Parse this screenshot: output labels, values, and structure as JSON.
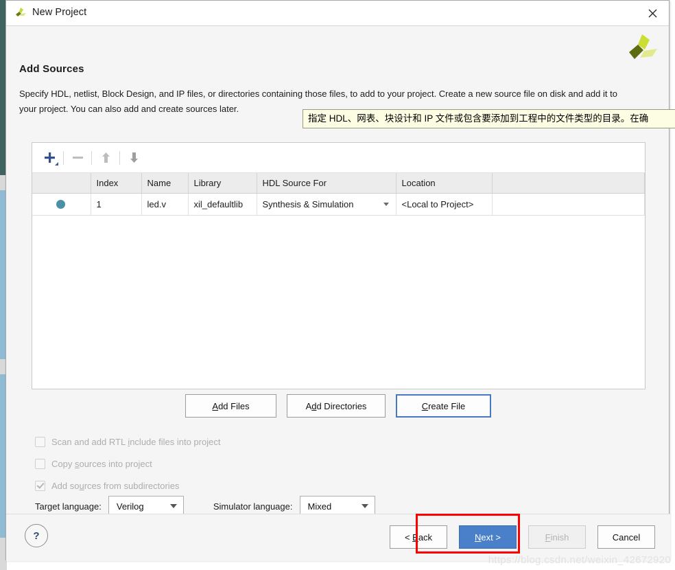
{
  "window": {
    "title": "New Project",
    "logo_icon": "vivado-logo-icon",
    "close_icon": "close-icon"
  },
  "header": {
    "title": "Add Sources",
    "description": "Specify HDL, netlist, Block Design, and IP files, or directories containing those files, to add to your project. Create a new source file on disk and add it to your project. You can also add and create sources later.",
    "logo_icon": "xilinx-pinwheel-logo-icon"
  },
  "tooltip": {
    "text": "指定 HDL、网表、块设计和 IP 文件或包含要添加到工程中的文件类型的目录。在确"
  },
  "table_toolbar": {
    "add_icon": "plus-icon",
    "remove_icon": "minus-icon",
    "move_up_icon": "arrow-up-icon",
    "move_down_icon": "arrow-down-icon"
  },
  "sources_table": {
    "columns": [
      "",
      "Index",
      "Name",
      "Library",
      "HDL Source For",
      "Location",
      ""
    ],
    "rows": [
      {
        "selected_marker": "selected-dot",
        "index": "1",
        "name": "led.v",
        "library": "xil_defaultlib",
        "hdl_source_for": "Synthesis & Simulation",
        "location": "<Local to Project>"
      }
    ]
  },
  "action_buttons": {
    "add_files": "Add Files",
    "add_files_mnemonic": "A",
    "add_files_rest": "dd Files",
    "add_directories_pre": "A",
    "add_directories_mnemonic": "d",
    "add_directories_rest": "d Directories",
    "create_file_mnemonic": "C",
    "create_file_rest": "reate File"
  },
  "options": [
    {
      "label_pre": "Scan and add RTL ",
      "label_mnemonic": "i",
      "label_rest": "nclude files into project",
      "checked": false,
      "enabled": false
    },
    {
      "label_pre": "Copy ",
      "label_mnemonic": "s",
      "label_rest": "ources into project",
      "checked": false,
      "enabled": false
    },
    {
      "label_pre": "Add so",
      "label_mnemonic": "u",
      "label_rest": "rces from subdirectories",
      "checked": true,
      "enabled": false
    }
  ],
  "languages": {
    "target_label": "Target language:",
    "target_value": "Verilog",
    "simulator_label": "Simulator language:",
    "simulator_value": "Mixed"
  },
  "bottom_bar": {
    "help_glyph": "?",
    "back_pre": "< ",
    "back_mnemonic": "B",
    "back_rest": "ack",
    "next_mnemonic": "N",
    "next_rest": "ext >",
    "finish_mnemonic": "F",
    "finish_rest": "inish",
    "cancel": "Cancel"
  },
  "watermark": {
    "text": "https://blog.csdn.net/weixin_42672920"
  },
  "colors": {
    "primary_button": "#4a7fc9",
    "focus_border": "#4a77c4",
    "annotation": "#ff0000",
    "selected_dot": "#4a91a8",
    "tooltip_bg": "#fdfde4",
    "logo_bright": "#ccdd33",
    "logo_dark": "#5f6b0f",
    "logo_pale": "#e3ea8e"
  }
}
